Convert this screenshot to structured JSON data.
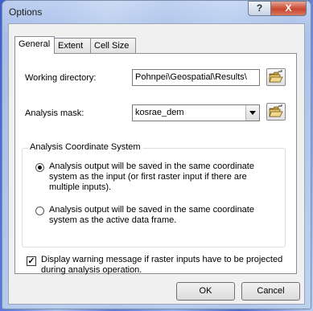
{
  "window": {
    "title": "Options",
    "help_label": "?",
    "close_label": "X"
  },
  "tabs": [
    {
      "label": "General",
      "active": true
    },
    {
      "label": "Extent",
      "active": false
    },
    {
      "label": "Cell Size",
      "active": false
    }
  ],
  "general": {
    "working_directory_label": "Working directory:",
    "working_directory_value": "Pohnpei\\Geospatial\\Results\\",
    "analysis_mask_label": "Analysis mask:",
    "analysis_mask_value": "kosrae_dem",
    "coord_system_title": "Analysis Coordinate System",
    "radio_options": [
      {
        "text": "Analysis output will be saved in the same coordinate system as the input (or first raster input if there are multiple inputs).",
        "selected": true
      },
      {
        "text": "Analysis output will be saved in the same coordinate system as the active data frame.",
        "selected": false
      }
    ],
    "warning_checkbox_label": "Display warning message if raster inputs have to be projected during analysis operation.",
    "warning_checkbox_checked": true
  },
  "buttons": {
    "ok": "OK",
    "cancel": "Cancel"
  },
  "icons": {
    "browse": "open-folder-icon"
  }
}
